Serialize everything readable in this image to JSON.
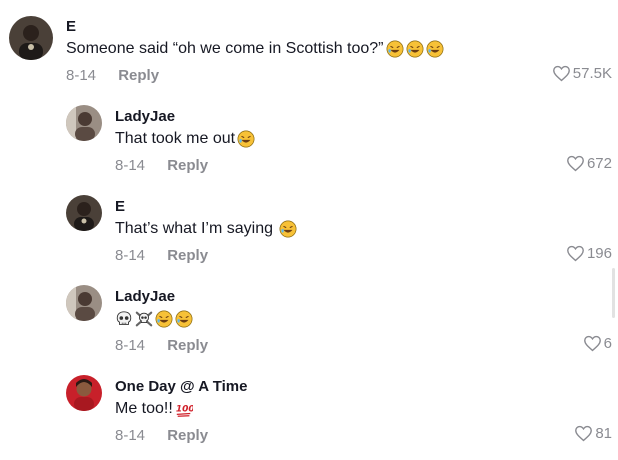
{
  "comments": [
    {
      "username": "E",
      "text": "Someone said “oh we come in Scottish too?”",
      "emojis": [
        "rofl-emoji",
        "rofl-emoji",
        "rofl-emoji"
      ],
      "date": "8-14",
      "reply_label": "Reply",
      "likes": "57.5K"
    },
    {
      "username": "LadyJae",
      "text": "That took me out",
      "emojis": [
        "rofl-emoji"
      ],
      "date": "8-14",
      "reply_label": "Reply",
      "likes": "672"
    },
    {
      "username": "E",
      "text": "That’s what I’m saying ",
      "emojis": [
        "rofl-emoji"
      ],
      "date": "8-14",
      "reply_label": "Reply",
      "likes": "196"
    },
    {
      "username": "LadyJae",
      "text": "",
      "emojis": [
        "skull-emoji",
        "skull-crossbones-emoji",
        "rofl-emoji",
        "rofl-emoji"
      ],
      "date": "8-14",
      "reply_label": "Reply",
      "likes": "6"
    },
    {
      "username": "One Day @ A Time",
      "text": "Me too!!",
      "emojis": [
        "hundred-points-emoji"
      ],
      "date": "8-14",
      "reply_label": "Reply",
      "likes": "81"
    }
  ],
  "colors": {
    "text": "#161823",
    "muted": "#8a8b91",
    "background": "#ffffff"
  }
}
